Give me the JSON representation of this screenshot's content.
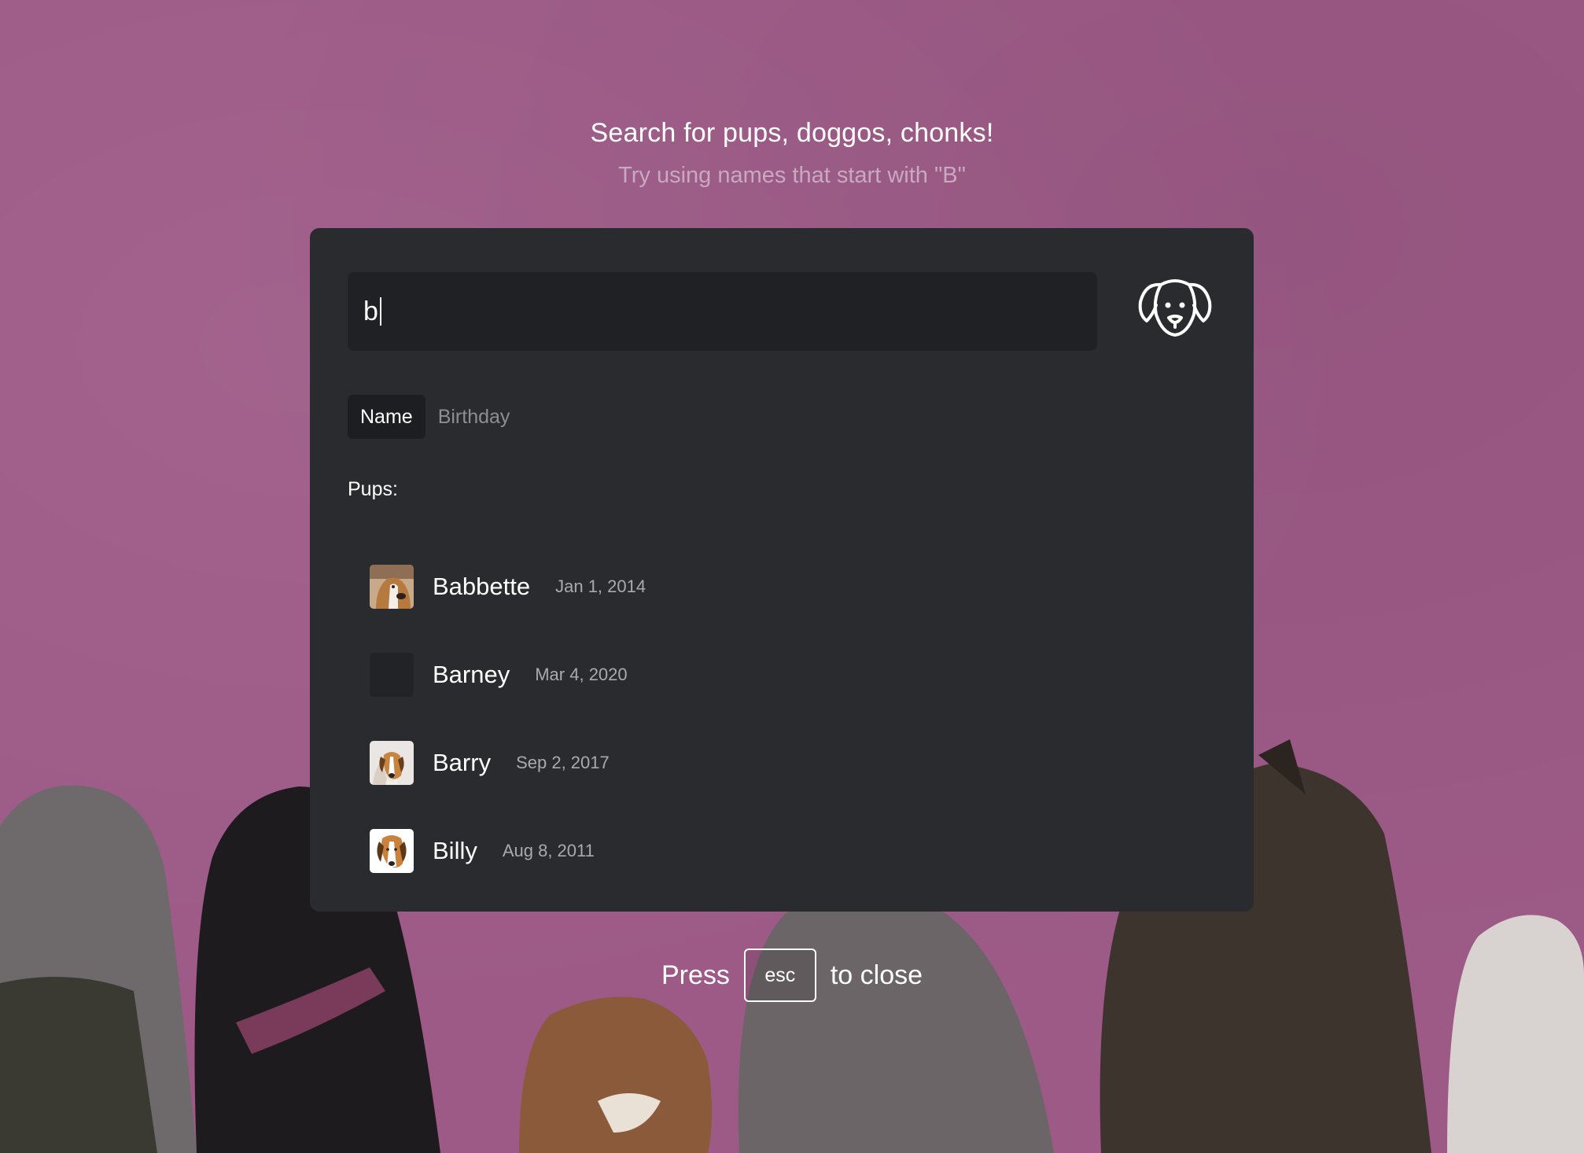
{
  "header": {
    "title": "Search for pups, doggos, chonks!",
    "subtitle": "Try using names that start with \"B\""
  },
  "search": {
    "value": "b",
    "logo_icon": "dog-face-icon"
  },
  "tabs": [
    {
      "label": "Name",
      "active": true
    },
    {
      "label": "Birthday",
      "active": false
    }
  ],
  "results": {
    "section_label": "Pups:",
    "items": [
      {
        "name": "Babbette",
        "date": "Jan 1, 2014",
        "avatar": "beagle-photo"
      },
      {
        "name": "Barney",
        "date": "Mar 4, 2020",
        "avatar": "empty"
      },
      {
        "name": "Barry",
        "date": "Sep 2, 2017",
        "avatar": "beagle-photo"
      },
      {
        "name": "Billy",
        "date": "Aug 8, 2011",
        "avatar": "beagle-photo"
      }
    ]
  },
  "footer": {
    "prefix": "Press",
    "key": "esc",
    "suffix": "to close"
  },
  "colors": {
    "background": "#9d5a87",
    "panel": "#2a2b2e",
    "input": "#202124"
  }
}
